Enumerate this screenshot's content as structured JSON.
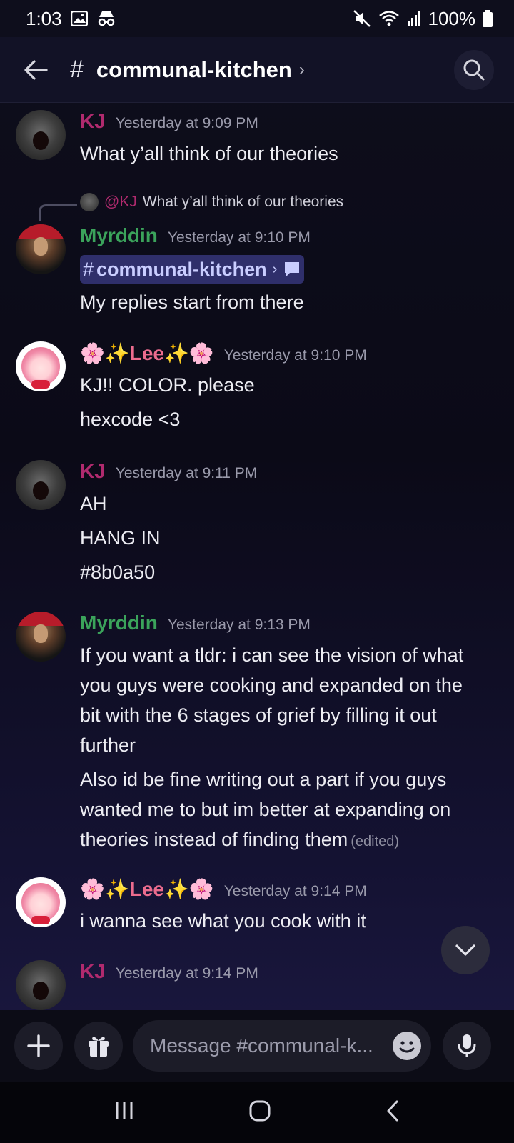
{
  "status_bar": {
    "time": "1:03",
    "battery": "100%"
  },
  "header": {
    "hash": "#",
    "channel": "communal-kitchen",
    "chevron": "›"
  },
  "messages": [
    {
      "author": "KJ",
      "timestamp": "Yesterday at 9:09 PM",
      "lines": [
        "What y’all think of our theories"
      ]
    },
    {
      "reply": {
        "mention": "@KJ",
        "text": "What y’all think of our theories"
      },
      "author": "Myrddin",
      "timestamp": "Yesterday at 9:10 PM",
      "channel_mention": {
        "hash": "#",
        "name": "communal-kitchen",
        "chevron": "›"
      },
      "lines": [
        "My replies start from there"
      ]
    },
    {
      "author_prefix": "🌸✨",
      "author": "Lee",
      "author_suffix": "✨🌸",
      "timestamp": "Yesterday at 9:10 PM",
      "lines": [
        "KJ!! COLOR. please",
        "hexcode <3"
      ]
    },
    {
      "author": "KJ",
      "timestamp": "Yesterday at 9:11 PM",
      "lines": [
        "AH",
        "HANG IN",
        "#8b0a50"
      ]
    },
    {
      "author": "Myrddin",
      "timestamp": "Yesterday at 9:13 PM",
      "lines": [
        "If you want a tldr: i can see the vision of what",
        "you guys were cooking and expanded on the",
        "bit with the 6 stages of grief by filling it out",
        "further",
        "Also id be fine writing out a part if you guys",
        "wanted me to but im better at expanding on",
        "theories instead of finding them"
      ],
      "edited": "(edited)"
    },
    {
      "author_prefix": "🌸✨",
      "author": "Lee",
      "author_suffix": "✨🌸",
      "timestamp": "Yesterday at 9:14 PM",
      "lines": [
        "i wanna see what you cook with it"
      ]
    },
    {
      "author": "KJ",
      "timestamp": "Yesterday at 9:14 PM",
      "lines": []
    }
  ],
  "composer": {
    "placeholder": "Message #communal-k..."
  },
  "colors": {
    "kj": "#b02a6e",
    "myrddin": "#3ba35b",
    "lee": "#ec6c8e",
    "mention_bg": "#2f2f6b"
  },
  "icons": [
    "back-arrow-icon",
    "search-icon",
    "plus-icon",
    "gift-icon",
    "emoji-icon",
    "mic-icon",
    "chevron-down-icon",
    "speech-bubble-icon",
    "wifi-icon",
    "signal-icon",
    "mute-icon",
    "battery-icon",
    "gallery-icon",
    "incognito-icon"
  ]
}
